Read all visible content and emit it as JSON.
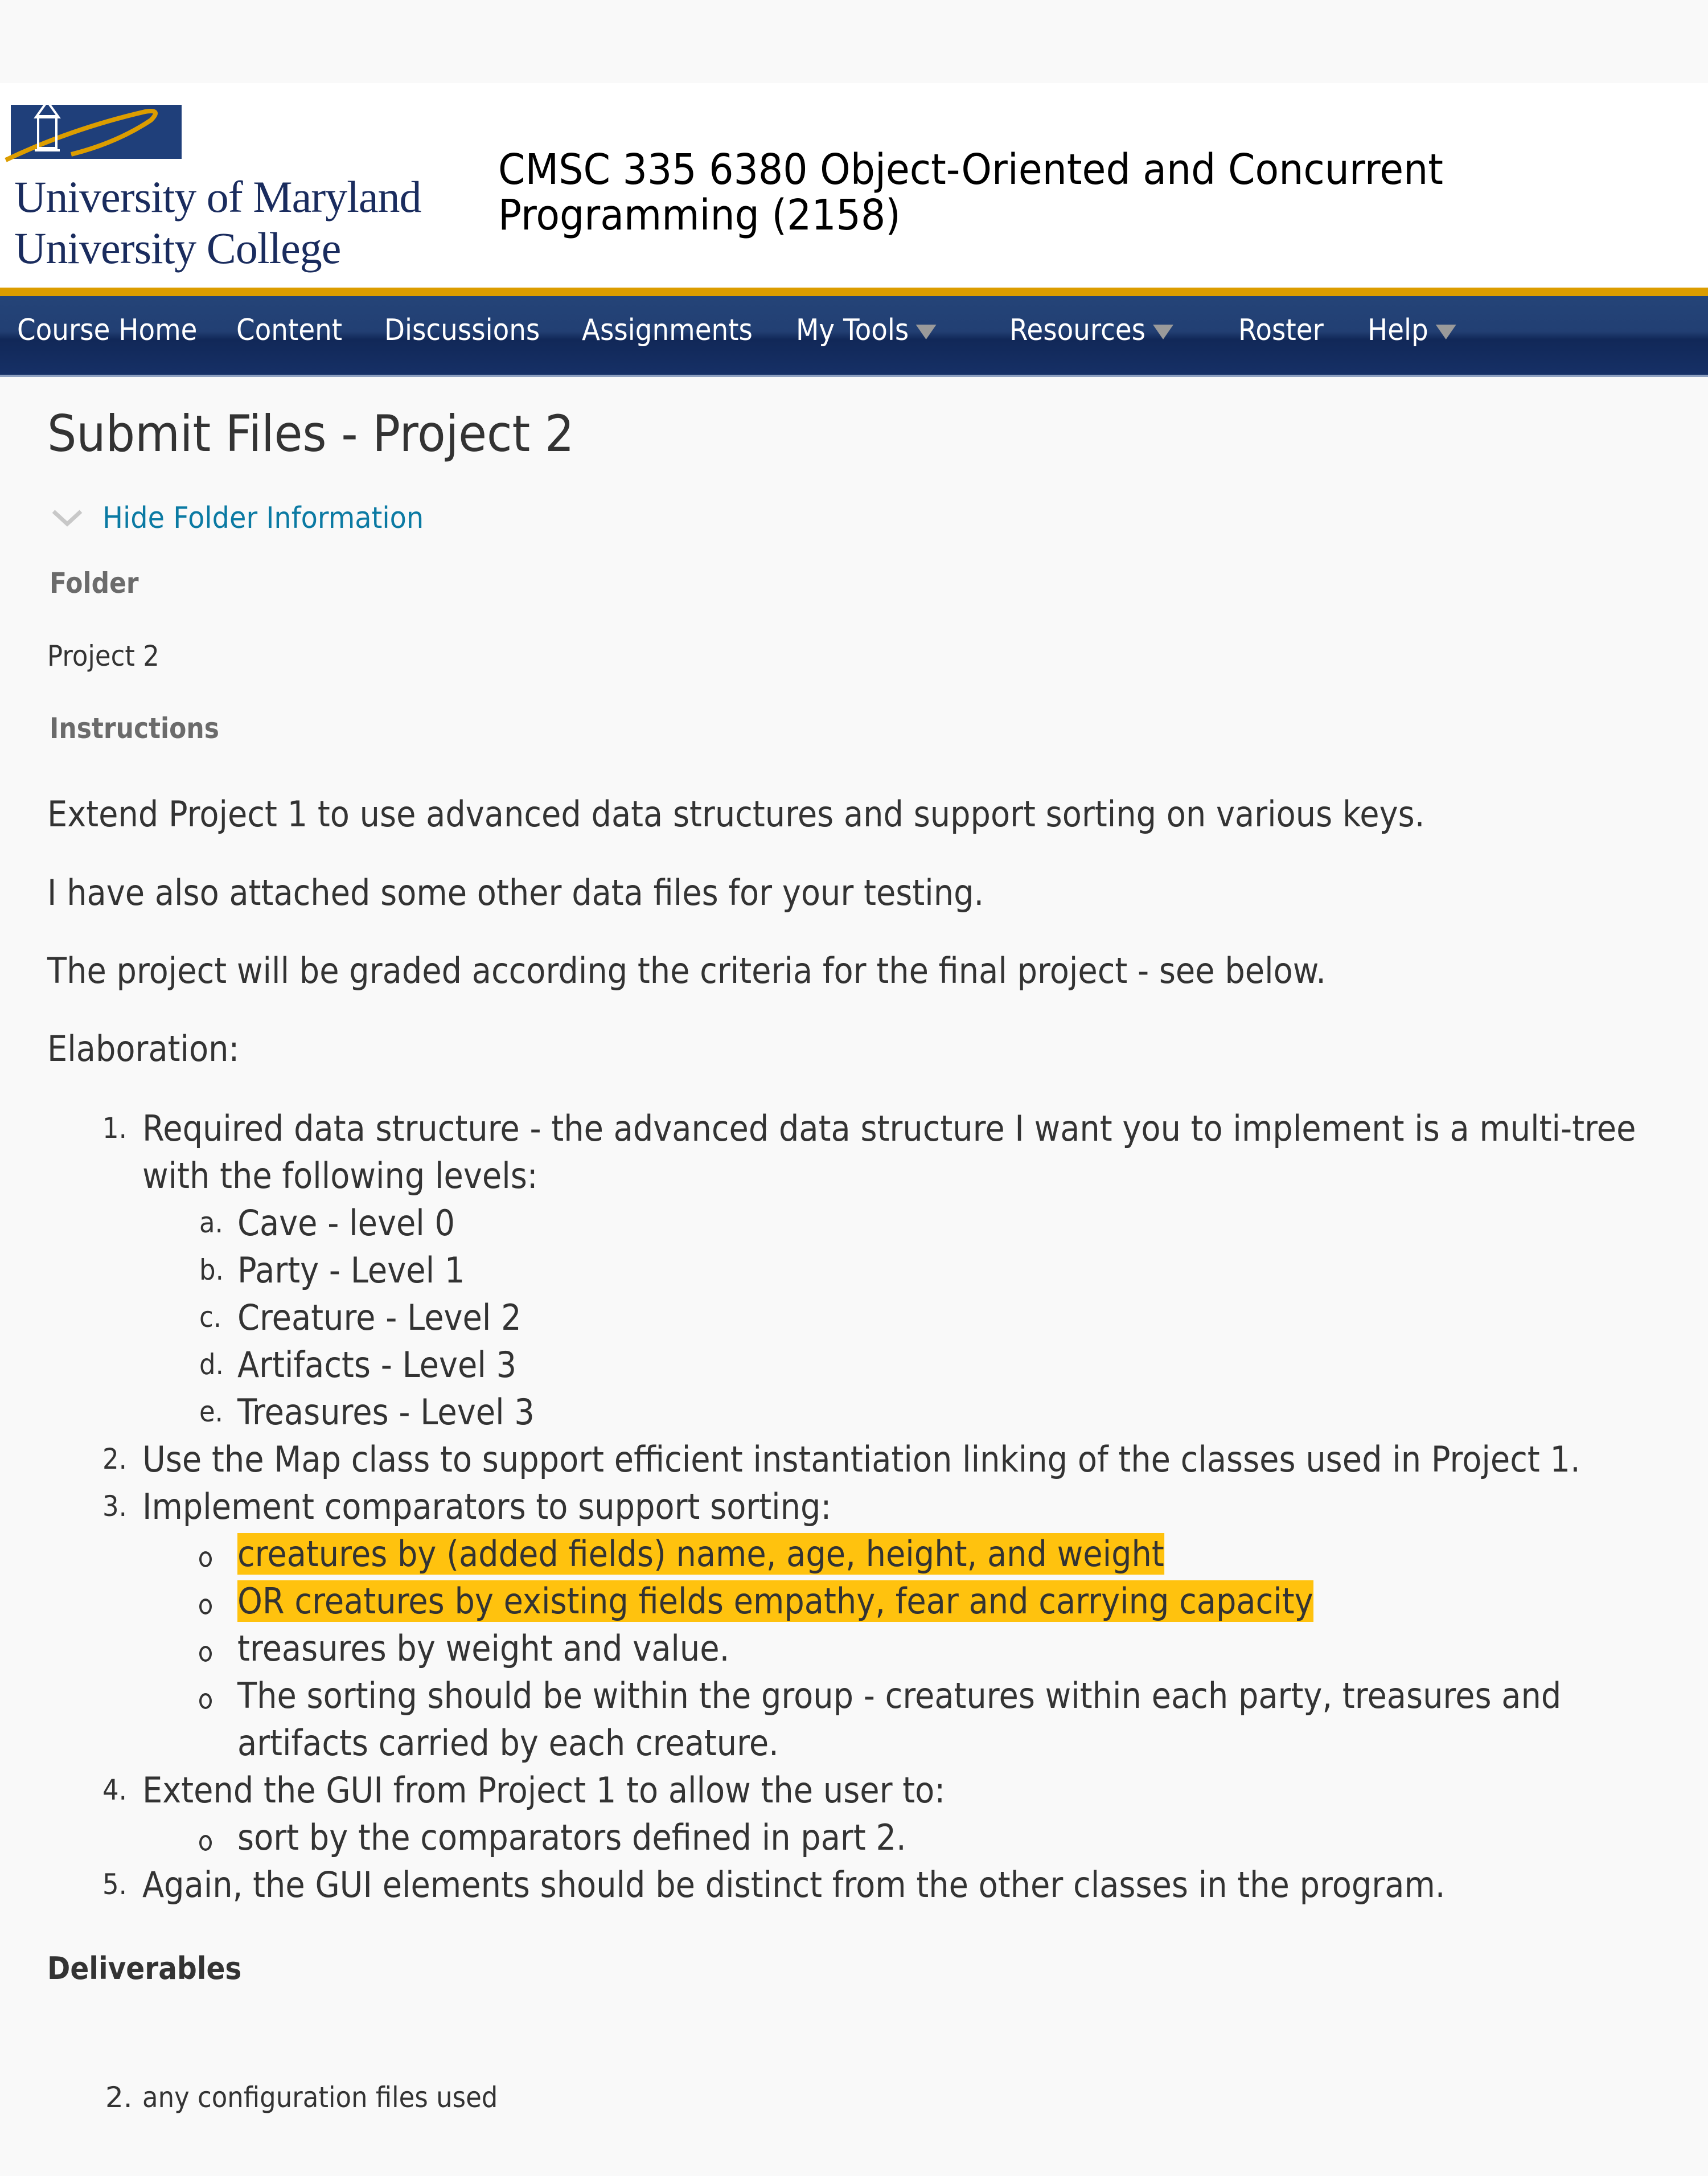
{
  "header": {
    "logo": {
      "line1": "University of Maryland",
      "line2": "University College",
      "brand_blue": "#1f3f7a",
      "brand_gold": "#dc9d00"
    },
    "course_title": "CMSC 335 6380 Object-Oriented and Concurrent Programming (2158)"
  },
  "nav": {
    "items": [
      {
        "label": "Course Home",
        "dropdown": false
      },
      {
        "label": "Content",
        "dropdown": false
      },
      {
        "label": "Discussions",
        "dropdown": false
      },
      {
        "label": "Assignments",
        "dropdown": false
      },
      {
        "label": "My Tools",
        "dropdown": true
      },
      {
        "label": "Resources",
        "dropdown": true
      },
      {
        "label": "Roster",
        "dropdown": false
      },
      {
        "label": "Help",
        "dropdown": true
      }
    ],
    "background": "#1c3a6e"
  },
  "page": {
    "title": "Submit Files - Project 2",
    "toggle_label": "Hide Folder Information",
    "folder_label": "Folder",
    "folder_value": "Project 2",
    "instructions_label": "Instructions",
    "paragraphs": [
      "Extend Project 1 to use advanced data structures and support sorting on various keys.",
      "I have also attached some other data files for your testing.",
      "The project will be graded according the criteria for the final project - see below.",
      "Elaboration:"
    ],
    "list": [
      {
        "marker": "1.",
        "text_line1": "Required data structure - the advanced data structure I want you to implement is a multi-tree",
        "text_line2": "with the following levels:",
        "sub": [
          {
            "marker": "a.",
            "text": "Cave - level 0"
          },
          {
            "marker": "b.",
            "text": "Party - Level 1"
          },
          {
            "marker": "c.",
            "text": "Creature - Level 2"
          },
          {
            "marker": "d.",
            "text": "Artifacts - Level 3"
          },
          {
            "marker": "e.",
            "text": "Treasures - Level 3"
          }
        ]
      },
      {
        "marker": "2.",
        "text": "Use the Map class to support efficient instantiation linking of the classes used in Project 1."
      },
      {
        "marker": "3.",
        "text": "Implement comparators to support sorting:",
        "sub": [
          {
            "text": "creatures by (added fields) name, age, height, and weight",
            "highlighted": true
          },
          {
            "text": "OR creatures by existing fields empathy, fear and carrying capacity",
            "highlighted": true
          },
          {
            "text": "treasures by weight and value.",
            "highlighted": false
          },
          {
            "text_line1": "The sorting should be within the group - creatures within each party, treasures and",
            "text_line2": "artifacts carried by each creature.",
            "highlighted": false
          }
        ]
      },
      {
        "marker": "4.",
        "text": "Extend the GUI from Project 1 to allow the user to:",
        "sub": [
          {
            "text": "sort by the comparators defined in part 2."
          }
        ]
      },
      {
        "marker": "5.",
        "text": "Again, the GUI elements should be distinct from the other classes in the program."
      }
    ],
    "highlight_color": "#ffc20e",
    "deliverables_title": "Deliverables",
    "deliverables": [
      {
        "marker": "2.",
        "text": "any configuration files used"
      }
    ]
  }
}
